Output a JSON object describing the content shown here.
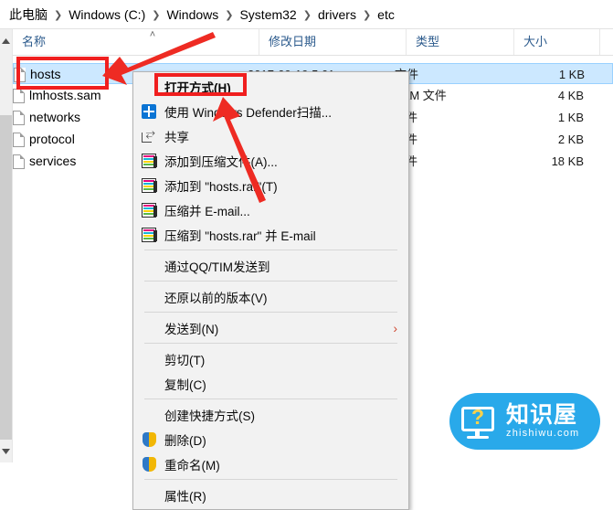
{
  "breadcrumb": {
    "separator": "❯",
    "items": [
      "此电脑",
      "Windows (C:)",
      "Windows",
      "System32",
      "drivers",
      "etc"
    ]
  },
  "columns": {
    "name": "名称",
    "date": "修改日期",
    "type": "类型",
    "size": "大小",
    "sort_indicator": "˄"
  },
  "files": [
    {
      "name": "hosts",
      "date": "2017-09-19 5:01",
      "type": "文件",
      "size": "1 KB",
      "selected": true
    },
    {
      "name": "lmhosts.sam",
      "date": "",
      "type": "SAM 文件",
      "size": "4 KB",
      "selected": false
    },
    {
      "name": "networks",
      "date": "",
      "type": "文件",
      "size": "1 KB",
      "selected": false
    },
    {
      "name": "protocol",
      "date": "",
      "type": "文件",
      "size": "2 KB",
      "selected": false
    },
    {
      "name": "services",
      "date": "",
      "type": "文件",
      "size": "18 KB",
      "selected": false
    }
  ],
  "context_menu": {
    "items": [
      {
        "label": "打开方式(H)",
        "icon": "none",
        "bold": true,
        "submenu": false
      },
      {
        "label": "使用 Windows Defender扫描...",
        "icon": "defender",
        "bold": false,
        "submenu": false
      },
      {
        "label": "共享",
        "icon": "share",
        "bold": false,
        "submenu": false
      },
      {
        "label": "添加到压缩文件(A)...",
        "icon": "rar",
        "bold": false,
        "submenu": false
      },
      {
        "label": "添加到 \"hosts.rar\"(T)",
        "icon": "rar",
        "bold": false,
        "submenu": false
      },
      {
        "label": "压缩并 E-mail...",
        "icon": "rar",
        "bold": false,
        "submenu": false
      },
      {
        "label": "压缩到 \"hosts.rar\" 并 E-mail",
        "icon": "rar",
        "bold": false,
        "submenu": false
      },
      {
        "separator": true
      },
      {
        "label": "通过QQ/TIM发送到",
        "icon": "none",
        "bold": false,
        "submenu": false
      },
      {
        "separator": true
      },
      {
        "label": "还原以前的版本(V)",
        "icon": "none",
        "bold": false,
        "submenu": false
      },
      {
        "separator": true
      },
      {
        "label": "发送到(N)",
        "icon": "none",
        "bold": false,
        "submenu": true,
        "submenu_glyph": "›"
      },
      {
        "separator": true
      },
      {
        "label": "剪切(T)",
        "icon": "none",
        "bold": false,
        "submenu": false
      },
      {
        "label": "复制(C)",
        "icon": "none",
        "bold": false,
        "submenu": false
      },
      {
        "separator": true
      },
      {
        "label": "创建快捷方式(S)",
        "icon": "none",
        "bold": false,
        "submenu": false
      },
      {
        "label": "删除(D)",
        "icon": "uac",
        "bold": false,
        "submenu": false
      },
      {
        "label": "重命名(M)",
        "icon": "uac",
        "bold": false,
        "submenu": false
      },
      {
        "separator": true
      },
      {
        "label": "属性(R)",
        "icon": "none",
        "bold": false,
        "submenu": false
      }
    ]
  },
  "annotations": {
    "highlight_color": "#f01f1f",
    "boxes": [
      "hosts-file-row",
      "open-with-menu-item"
    ],
    "arrows": [
      "arrow-to-hosts-file",
      "arrow-to-open-with"
    ]
  },
  "scrollbar": {
    "up_glyph": "▲",
    "down_glyph": "▼"
  },
  "watermark": {
    "title_cn": "知识屋",
    "domain": "zhishiwu.com",
    "question_mark": "?",
    "background": "#29a9ea"
  }
}
